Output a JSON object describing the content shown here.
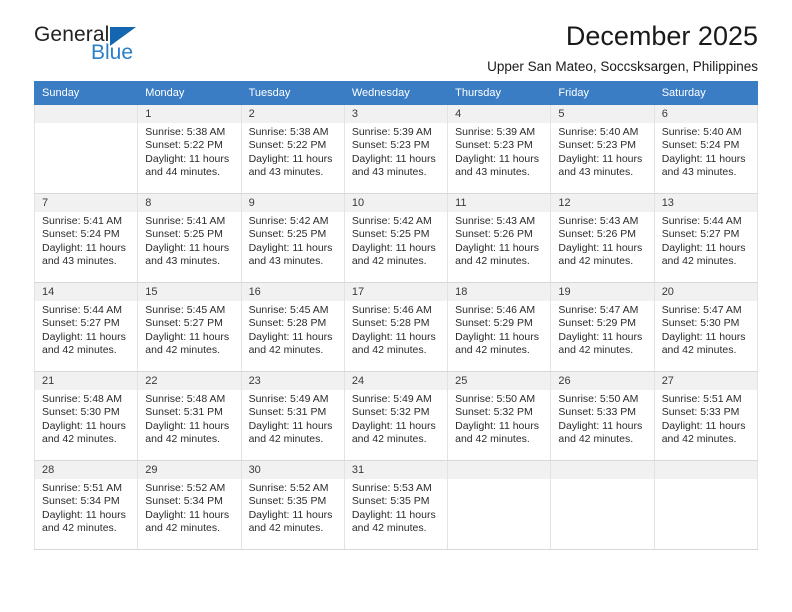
{
  "brand": {
    "line1": "General",
    "line2": "Blue",
    "logo_icon": "blue-triangle-icon",
    "accent_color": "#2a7fc9"
  },
  "header": {
    "title": "December 2025",
    "subtitle": "Upper San Mateo, Soccsksargen, Philippines"
  },
  "calendar": {
    "header_bg": "#3b7dc4",
    "daynum_bg": "#f1f1f1",
    "weekdays": [
      "Sunday",
      "Monday",
      "Tuesday",
      "Wednesday",
      "Thursday",
      "Friday",
      "Saturday"
    ],
    "labels": {
      "sunrise": "Sunrise:",
      "sunset": "Sunset:",
      "daylight": "Daylight:"
    },
    "weeks": [
      [
        {
          "day": "",
          "empty": true,
          "sunrise": "",
          "sunset": "",
          "daylight_a": "",
          "daylight_b": ""
        },
        {
          "day": "1",
          "sunrise": "Sunrise: 5:38 AM",
          "sunset": "Sunset: 5:22 PM",
          "daylight_a": "Daylight: 11 hours",
          "daylight_b": "and 44 minutes."
        },
        {
          "day": "2",
          "sunrise": "Sunrise: 5:38 AM",
          "sunset": "Sunset: 5:22 PM",
          "daylight_a": "Daylight: 11 hours",
          "daylight_b": "and 43 minutes."
        },
        {
          "day": "3",
          "sunrise": "Sunrise: 5:39 AM",
          "sunset": "Sunset: 5:23 PM",
          "daylight_a": "Daylight: 11 hours",
          "daylight_b": "and 43 minutes."
        },
        {
          "day": "4",
          "sunrise": "Sunrise: 5:39 AM",
          "sunset": "Sunset: 5:23 PM",
          "daylight_a": "Daylight: 11 hours",
          "daylight_b": "and 43 minutes."
        },
        {
          "day": "5",
          "sunrise": "Sunrise: 5:40 AM",
          "sunset": "Sunset: 5:23 PM",
          "daylight_a": "Daylight: 11 hours",
          "daylight_b": "and 43 minutes."
        },
        {
          "day": "6",
          "sunrise": "Sunrise: 5:40 AM",
          "sunset": "Sunset: 5:24 PM",
          "daylight_a": "Daylight: 11 hours",
          "daylight_b": "and 43 minutes."
        }
      ],
      [
        {
          "day": "7",
          "sunrise": "Sunrise: 5:41 AM",
          "sunset": "Sunset: 5:24 PM",
          "daylight_a": "Daylight: 11 hours",
          "daylight_b": "and 43 minutes."
        },
        {
          "day": "8",
          "sunrise": "Sunrise: 5:41 AM",
          "sunset": "Sunset: 5:25 PM",
          "daylight_a": "Daylight: 11 hours",
          "daylight_b": "and 43 minutes."
        },
        {
          "day": "9",
          "sunrise": "Sunrise: 5:42 AM",
          "sunset": "Sunset: 5:25 PM",
          "daylight_a": "Daylight: 11 hours",
          "daylight_b": "and 43 minutes."
        },
        {
          "day": "10",
          "sunrise": "Sunrise: 5:42 AM",
          "sunset": "Sunset: 5:25 PM",
          "daylight_a": "Daylight: 11 hours",
          "daylight_b": "and 42 minutes."
        },
        {
          "day": "11",
          "sunrise": "Sunrise: 5:43 AM",
          "sunset": "Sunset: 5:26 PM",
          "daylight_a": "Daylight: 11 hours",
          "daylight_b": "and 42 minutes."
        },
        {
          "day": "12",
          "sunrise": "Sunrise: 5:43 AM",
          "sunset": "Sunset: 5:26 PM",
          "daylight_a": "Daylight: 11 hours",
          "daylight_b": "and 42 minutes."
        },
        {
          "day": "13",
          "sunrise": "Sunrise: 5:44 AM",
          "sunset": "Sunset: 5:27 PM",
          "daylight_a": "Daylight: 11 hours",
          "daylight_b": "and 42 minutes."
        }
      ],
      [
        {
          "day": "14",
          "sunrise": "Sunrise: 5:44 AM",
          "sunset": "Sunset: 5:27 PM",
          "daylight_a": "Daylight: 11 hours",
          "daylight_b": "and 42 minutes."
        },
        {
          "day": "15",
          "sunrise": "Sunrise: 5:45 AM",
          "sunset": "Sunset: 5:27 PM",
          "daylight_a": "Daylight: 11 hours",
          "daylight_b": "and 42 minutes."
        },
        {
          "day": "16",
          "sunrise": "Sunrise: 5:45 AM",
          "sunset": "Sunset: 5:28 PM",
          "daylight_a": "Daylight: 11 hours",
          "daylight_b": "and 42 minutes."
        },
        {
          "day": "17",
          "sunrise": "Sunrise: 5:46 AM",
          "sunset": "Sunset: 5:28 PM",
          "daylight_a": "Daylight: 11 hours",
          "daylight_b": "and 42 minutes."
        },
        {
          "day": "18",
          "sunrise": "Sunrise: 5:46 AM",
          "sunset": "Sunset: 5:29 PM",
          "daylight_a": "Daylight: 11 hours",
          "daylight_b": "and 42 minutes."
        },
        {
          "day": "19",
          "sunrise": "Sunrise: 5:47 AM",
          "sunset": "Sunset: 5:29 PM",
          "daylight_a": "Daylight: 11 hours",
          "daylight_b": "and 42 minutes."
        },
        {
          "day": "20",
          "sunrise": "Sunrise: 5:47 AM",
          "sunset": "Sunset: 5:30 PM",
          "daylight_a": "Daylight: 11 hours",
          "daylight_b": "and 42 minutes."
        }
      ],
      [
        {
          "day": "21",
          "sunrise": "Sunrise: 5:48 AM",
          "sunset": "Sunset: 5:30 PM",
          "daylight_a": "Daylight: 11 hours",
          "daylight_b": "and 42 minutes."
        },
        {
          "day": "22",
          "sunrise": "Sunrise: 5:48 AM",
          "sunset": "Sunset: 5:31 PM",
          "daylight_a": "Daylight: 11 hours",
          "daylight_b": "and 42 minutes."
        },
        {
          "day": "23",
          "sunrise": "Sunrise: 5:49 AM",
          "sunset": "Sunset: 5:31 PM",
          "daylight_a": "Daylight: 11 hours",
          "daylight_b": "and 42 minutes."
        },
        {
          "day": "24",
          "sunrise": "Sunrise: 5:49 AM",
          "sunset": "Sunset: 5:32 PM",
          "daylight_a": "Daylight: 11 hours",
          "daylight_b": "and 42 minutes."
        },
        {
          "day": "25",
          "sunrise": "Sunrise: 5:50 AM",
          "sunset": "Sunset: 5:32 PM",
          "daylight_a": "Daylight: 11 hours",
          "daylight_b": "and 42 minutes."
        },
        {
          "day": "26",
          "sunrise": "Sunrise: 5:50 AM",
          "sunset": "Sunset: 5:33 PM",
          "daylight_a": "Daylight: 11 hours",
          "daylight_b": "and 42 minutes."
        },
        {
          "day": "27",
          "sunrise": "Sunrise: 5:51 AM",
          "sunset": "Sunset: 5:33 PM",
          "daylight_a": "Daylight: 11 hours",
          "daylight_b": "and 42 minutes."
        }
      ],
      [
        {
          "day": "28",
          "sunrise": "Sunrise: 5:51 AM",
          "sunset": "Sunset: 5:34 PM",
          "daylight_a": "Daylight: 11 hours",
          "daylight_b": "and 42 minutes."
        },
        {
          "day": "29",
          "sunrise": "Sunrise: 5:52 AM",
          "sunset": "Sunset: 5:34 PM",
          "daylight_a": "Daylight: 11 hours",
          "daylight_b": "and 42 minutes."
        },
        {
          "day": "30",
          "sunrise": "Sunrise: 5:52 AM",
          "sunset": "Sunset: 5:35 PM",
          "daylight_a": "Daylight: 11 hours",
          "daylight_b": "and 42 minutes."
        },
        {
          "day": "31",
          "sunrise": "Sunrise: 5:53 AM",
          "sunset": "Sunset: 5:35 PM",
          "daylight_a": "Daylight: 11 hours",
          "daylight_b": "and 42 minutes."
        },
        {
          "day": "",
          "empty": true,
          "sunrise": "",
          "sunset": "",
          "daylight_a": "",
          "daylight_b": ""
        },
        {
          "day": "",
          "empty": true,
          "sunrise": "",
          "sunset": "",
          "daylight_a": "",
          "daylight_b": ""
        },
        {
          "day": "",
          "empty": true,
          "sunrise": "",
          "sunset": "",
          "daylight_a": "",
          "daylight_b": ""
        }
      ]
    ]
  }
}
